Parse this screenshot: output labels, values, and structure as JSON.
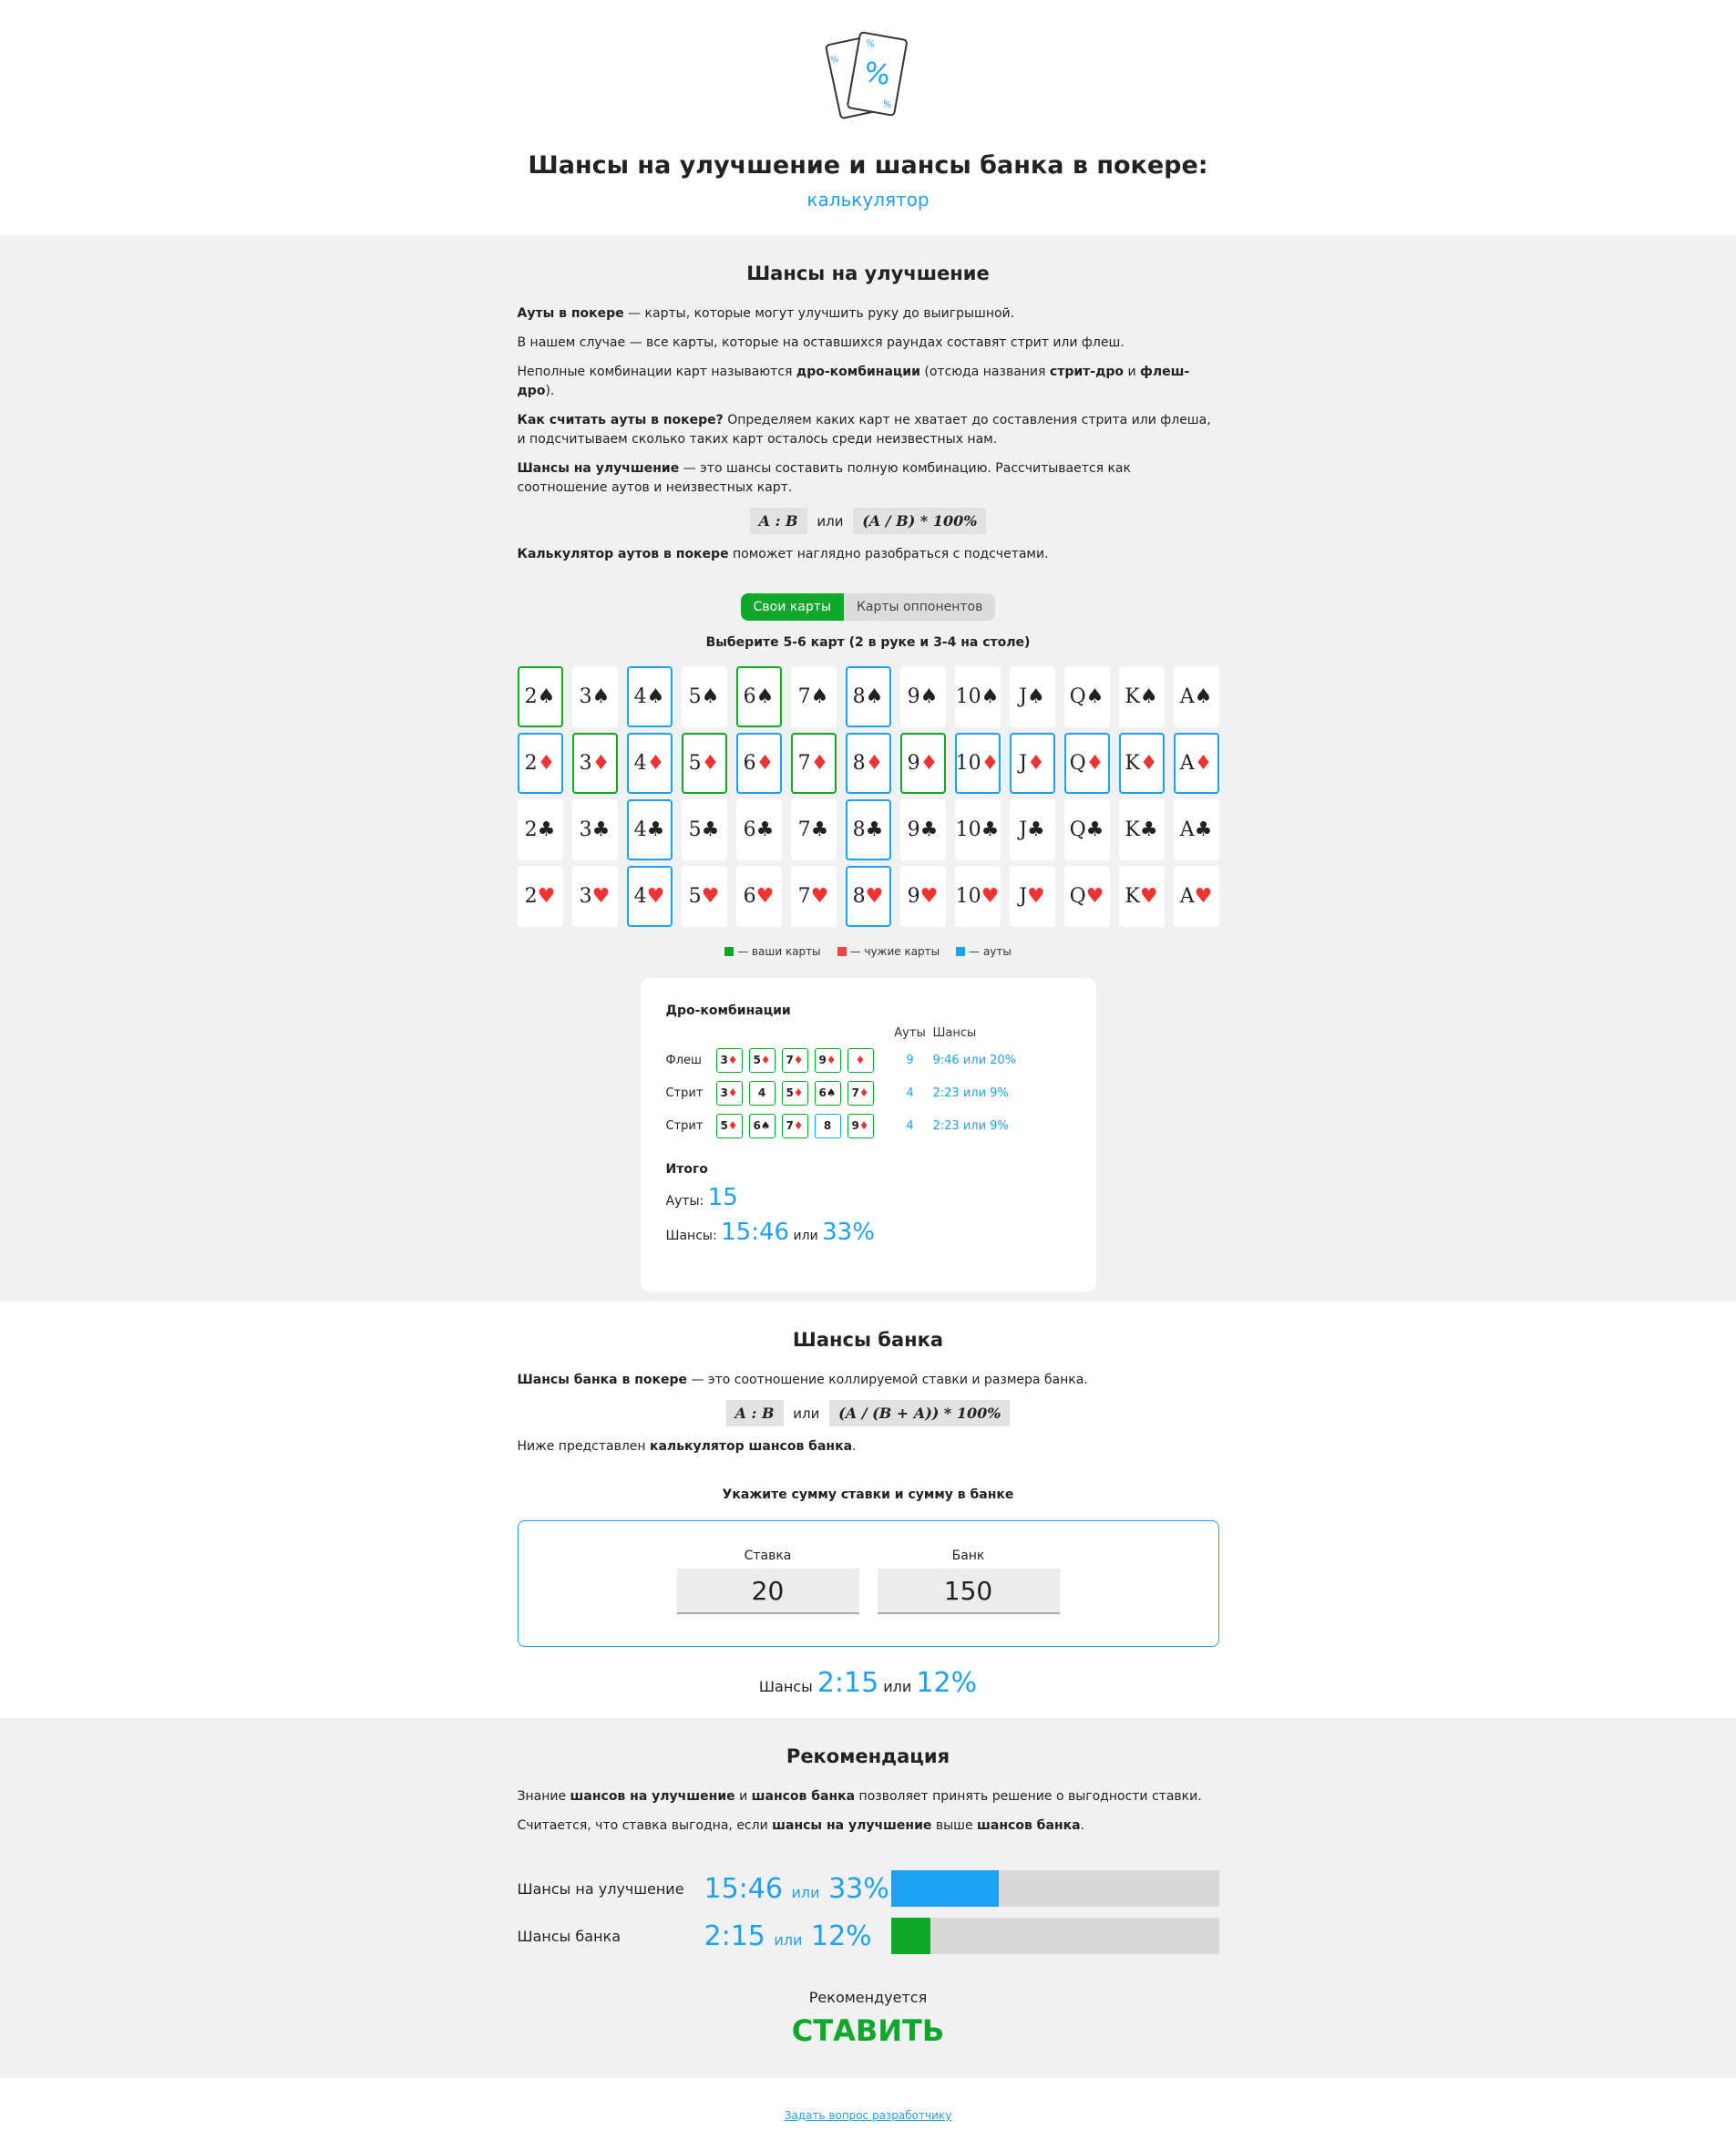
{
  "header": {
    "title": "Шансы на улучшение и шансы банка в покере:",
    "subtitle": "калькулятор",
    "logo_marks": [
      "%",
      "%",
      "%",
      "%"
    ]
  },
  "outs_section": {
    "title": "Шансы на улучшение",
    "p1": {
      "bold": "Ауты в покере",
      "text": " — карты, которые могут улучшить руку до выигрышной."
    },
    "p2": "В нашем случае — все карты, которые на оставшихся раундах составят стрит или флеш.",
    "p3": {
      "t1": "Неполные комбинации карт называются ",
      "b1": "дро-комбинации",
      "t2": " (отсюда названия ",
      "b2": "стрит-дро",
      "t3": " и ",
      "b3": "флеш-дро",
      "t4": ")."
    },
    "p4": {
      "bold": "Как считать ауты в покере?",
      "text": " Определяем каких карт не хватает до составления стрита или флеша, и подсчитываем сколько таких карт осталось среди неизвестных нам."
    },
    "p5": {
      "bold": "Шансы на улучшение",
      "text": " — это шансы составить полную комбинацию. Рассчитывается как соотношение аутов и неизвестных карт."
    },
    "formula1": "A : B",
    "formula_or": "или",
    "formula2": "(A / B) * 100%",
    "p6": {
      "bold": "Калькулятор аутов в покере",
      "text": " поможет наглядно разобраться с подсчетами."
    },
    "toggle": {
      "own": "Свои карты",
      "opponents": "Карты оппонентов"
    },
    "pick_title": "Выберите 5-6 карт (2 в руке и 3-4 на столе)",
    "ranks": [
      "2",
      "3",
      "4",
      "5",
      "6",
      "7",
      "8",
      "9",
      "10",
      "J",
      "Q",
      "K",
      "A"
    ],
    "rows": [
      {
        "suit": "♠",
        "red": false,
        "states": [
          "own",
          "",
          "out",
          "",
          "own",
          "",
          "out",
          "",
          "",
          "",
          "",
          "",
          ""
        ]
      },
      {
        "suit": "♦",
        "red": true,
        "states": [
          "out",
          "own",
          "out",
          "own",
          "out",
          "own",
          "out",
          "own",
          "out",
          "out",
          "out",
          "out",
          "out"
        ]
      },
      {
        "suit": "♣",
        "red": false,
        "states": [
          "",
          "",
          "out",
          "",
          "",
          "",
          "out",
          "",
          "",
          "",
          "",
          "",
          ""
        ]
      },
      {
        "suit": "♥",
        "red": true,
        "states": [
          "",
          "",
          "out",
          "",
          "",
          "",
          "out",
          "",
          "",
          "",
          "",
          "",
          ""
        ]
      }
    ],
    "legend": {
      "own": "— ваши карты",
      "opp": "— чужие карты",
      "outs": "— ауты"
    },
    "colors": {
      "own": "#0fa82b",
      "opp": "#ee4444",
      "outs": "#1da1f2"
    },
    "draws": {
      "title": "Дро-комбинации",
      "col_outs": "Ауты",
      "col_odds": "Шансы",
      "rows": [
        {
          "name": "Флеш",
          "cards": [
            {
              "r": "3",
              "s": "♦",
              "out": false
            },
            {
              "r": "5",
              "s": "♦",
              "out": false
            },
            {
              "r": "7",
              "s": "♦",
              "out": false
            },
            {
              "r": "9",
              "s": "♦",
              "out": false
            },
            {
              "r": "",
              "s": "♦",
              "out": false
            }
          ],
          "outs": "9",
          "odds": "9:46 или 20%"
        },
        {
          "name": "Стрит",
          "cards": [
            {
              "r": "3",
              "s": "♦",
              "out": false
            },
            {
              "r": "4",
              "s": "",
              "out": false
            },
            {
              "r": "5",
              "s": "♦",
              "out": false
            },
            {
              "r": "6",
              "s": "♠",
              "out": false
            },
            {
              "r": "7",
              "s": "♦",
              "out": false
            }
          ],
          "outs": "4",
          "odds": "2:23 или 9%"
        },
        {
          "name": "Стрит",
          "cards": [
            {
              "r": "5",
              "s": "♦",
              "out": false
            },
            {
              "r": "6",
              "s": "♠",
              "out": false
            },
            {
              "r": "7",
              "s": "♦",
              "out": false
            },
            {
              "r": "8",
              "s": "",
              "out": true
            },
            {
              "r": "9",
              "s": "♦",
              "out": false
            }
          ],
          "outs": "4",
          "odds": "2:23 или 9%"
        }
      ],
      "total_title": "Итого",
      "total_outs_label": "Ауты:",
      "total_outs": "15",
      "total_odds_label": "Шансы:",
      "total_ratio": "15:46",
      "total_or": "или",
      "total_pct": "33%"
    }
  },
  "bank_section": {
    "title": "Шансы банка",
    "p1": {
      "bold": "Шансы банка в покере",
      "text": " — это соотношение коллируемой ставки и размера банка."
    },
    "formula1": "A : B",
    "formula_or": "или",
    "formula2": "(A / (B + A)) * 100%",
    "p2": {
      "text": "Ниже представлен ",
      "bold": "калькулятор шансов банка",
      "end": "."
    },
    "enter_title": "Укажите сумму ставки и сумму в банке",
    "bet_label": "Ставка",
    "bet_value": "20",
    "pot_label": "Банк",
    "pot_value": "150",
    "result_label": "Шансы",
    "result_ratio": "2:15",
    "result_or": "или",
    "result_pct": "12%"
  },
  "rec_section": {
    "title": "Рекомендация",
    "p1": {
      "t1": "Знание ",
      "b1": "шансов на улучшение",
      "t2": " и ",
      "b2": "шансов банка",
      "t3": " позволяет принять решение о выгодности ставки."
    },
    "p2": {
      "t1": "Считается, что ставка выгодна, если ",
      "b1": "шансы на улучшение",
      "t2": " выше ",
      "b2": "шансов банка",
      "t3": "."
    },
    "improve_label": "Шансы на улучшение",
    "improve_ratio": "15:46",
    "improve_or": "или",
    "improve_pct": "33%",
    "improve_fraction": 0.33,
    "improve_color": "#1da1f2",
    "bank_label": "Шансы банка",
    "bank_ratio": "2:15",
    "bank_or": "или",
    "bank_pct": "12%",
    "bank_fraction": 0.12,
    "bank_color": "#0fa82b",
    "verdict_label": "Рекомендуется",
    "verdict": "СТАВИТЬ"
  },
  "footer": {
    "link": "Задать вопрос разработчику"
  }
}
